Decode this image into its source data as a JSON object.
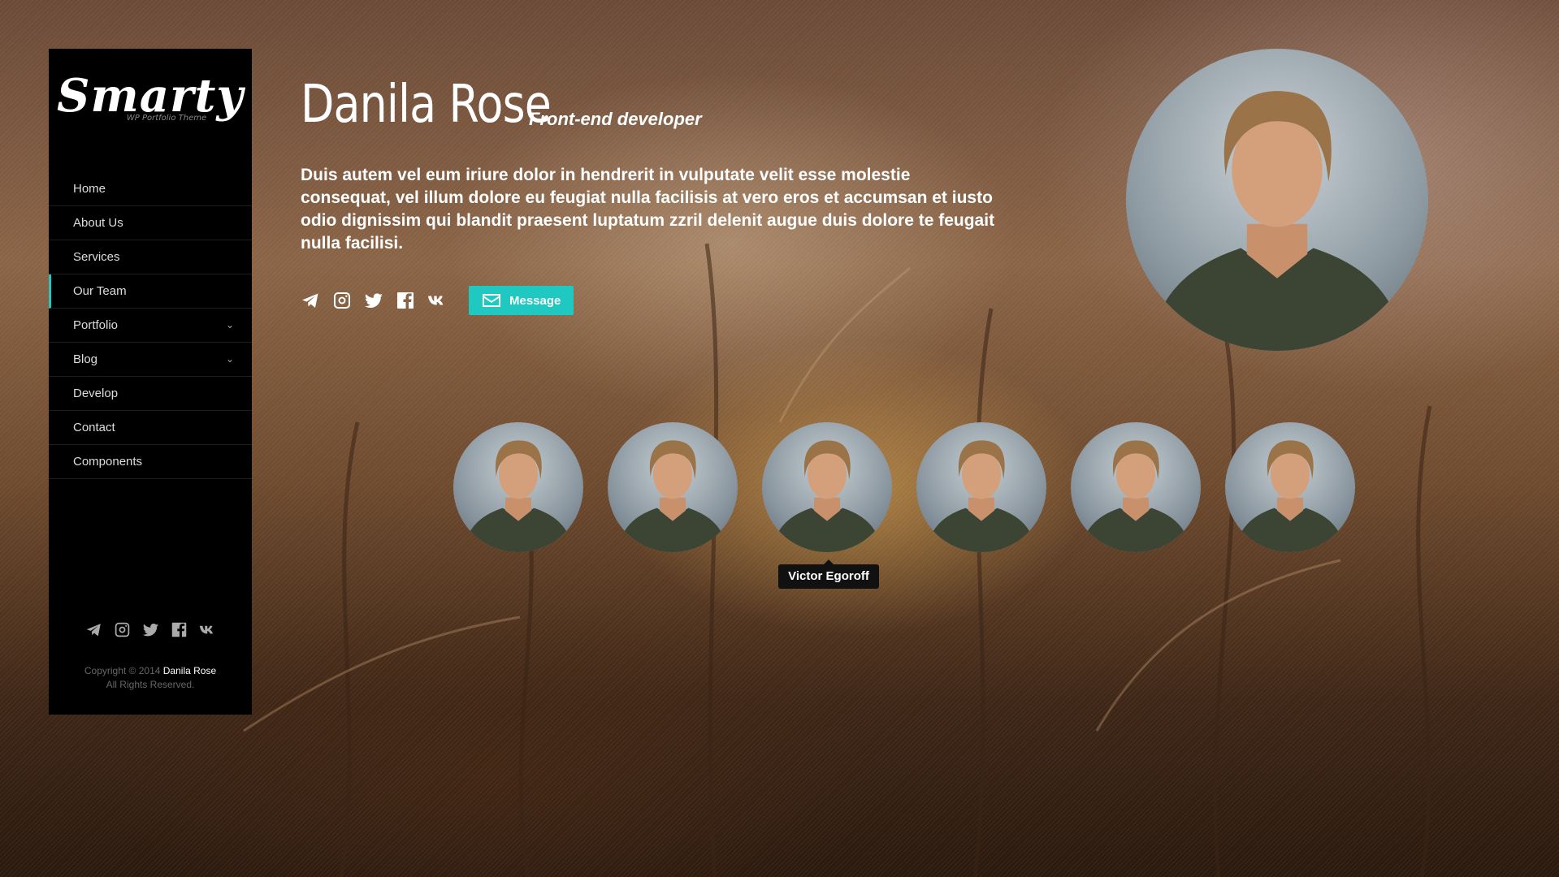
{
  "sidebar": {
    "logo_title": "Smarty",
    "logo_subtitle": "WP Portfolio Theme",
    "nav": [
      {
        "label": "Home"
      },
      {
        "label": "About Us"
      },
      {
        "label": "Services"
      },
      {
        "label": "Our Team",
        "active": true
      },
      {
        "label": "Portfolio",
        "has_children": true
      },
      {
        "label": "Blog",
        "has_children": true
      },
      {
        "label": "Develop"
      },
      {
        "label": "Contact"
      },
      {
        "label": "Components"
      }
    ],
    "social_icons": [
      "telegram-icon",
      "instagram-icon",
      "twitter-icon",
      "facebook-icon",
      "vk-icon"
    ],
    "copyright_prefix": "Copyright © 2014",
    "copyright_name": "Danila Rose",
    "copyright_suffix": "All Rights Reserved."
  },
  "profile": {
    "name": "Danila Rose",
    "role": "Front-end developer",
    "bio": "Duis autem vel eum iriure dolor in hendrerit in vulputate velit esse molestie consequat, vel illum dolore eu feugiat nulla facilisis at vero eros et accumsan et iusto odio dignissim qui blandit praesent luptatum zzril delenit augue duis dolore te feugait nulla facilisi.",
    "social_icons": [
      "telegram-icon",
      "instagram-icon",
      "twitter-icon",
      "facebook-icon",
      "vk-icon"
    ],
    "message_button": "Message"
  },
  "team": {
    "members_shown": 6,
    "tooltip": "Victor Egoroff"
  },
  "colors": {
    "accent": "#1fc8c0",
    "sidebar_bg": "#000000"
  }
}
